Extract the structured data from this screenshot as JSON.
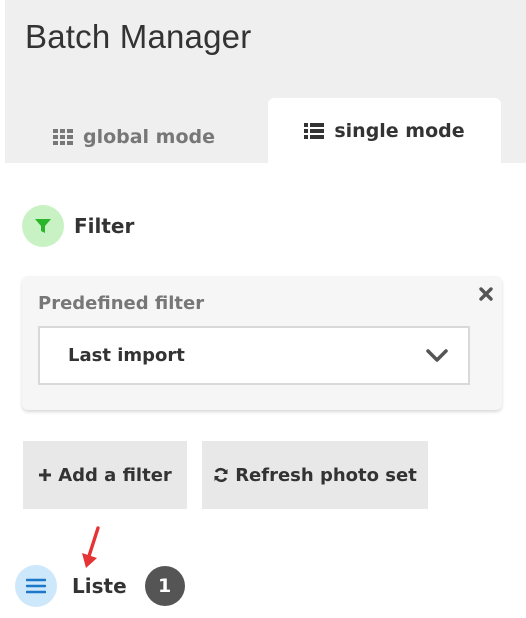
{
  "app": {
    "title": "Batch Manager"
  },
  "tabs": [
    {
      "label": "global mode",
      "icon": "grid-icon",
      "active": false
    },
    {
      "label": "single mode",
      "icon": "list-icon",
      "active": true
    }
  ],
  "filter_section": {
    "title": "Filter",
    "icon": "filter-icon",
    "icon_color": "#2ab52a"
  },
  "predefined_filter": {
    "label": "Predefined filter",
    "selected": "Last import"
  },
  "actions": {
    "add_filter": "Add a filter",
    "refresh": "Refresh photo set"
  },
  "list_section": {
    "title": "Liste",
    "count": "1",
    "icon": "menu-icon",
    "icon_color": "#1e78c8"
  },
  "annotation": {
    "arrow_color": "#e63434"
  }
}
